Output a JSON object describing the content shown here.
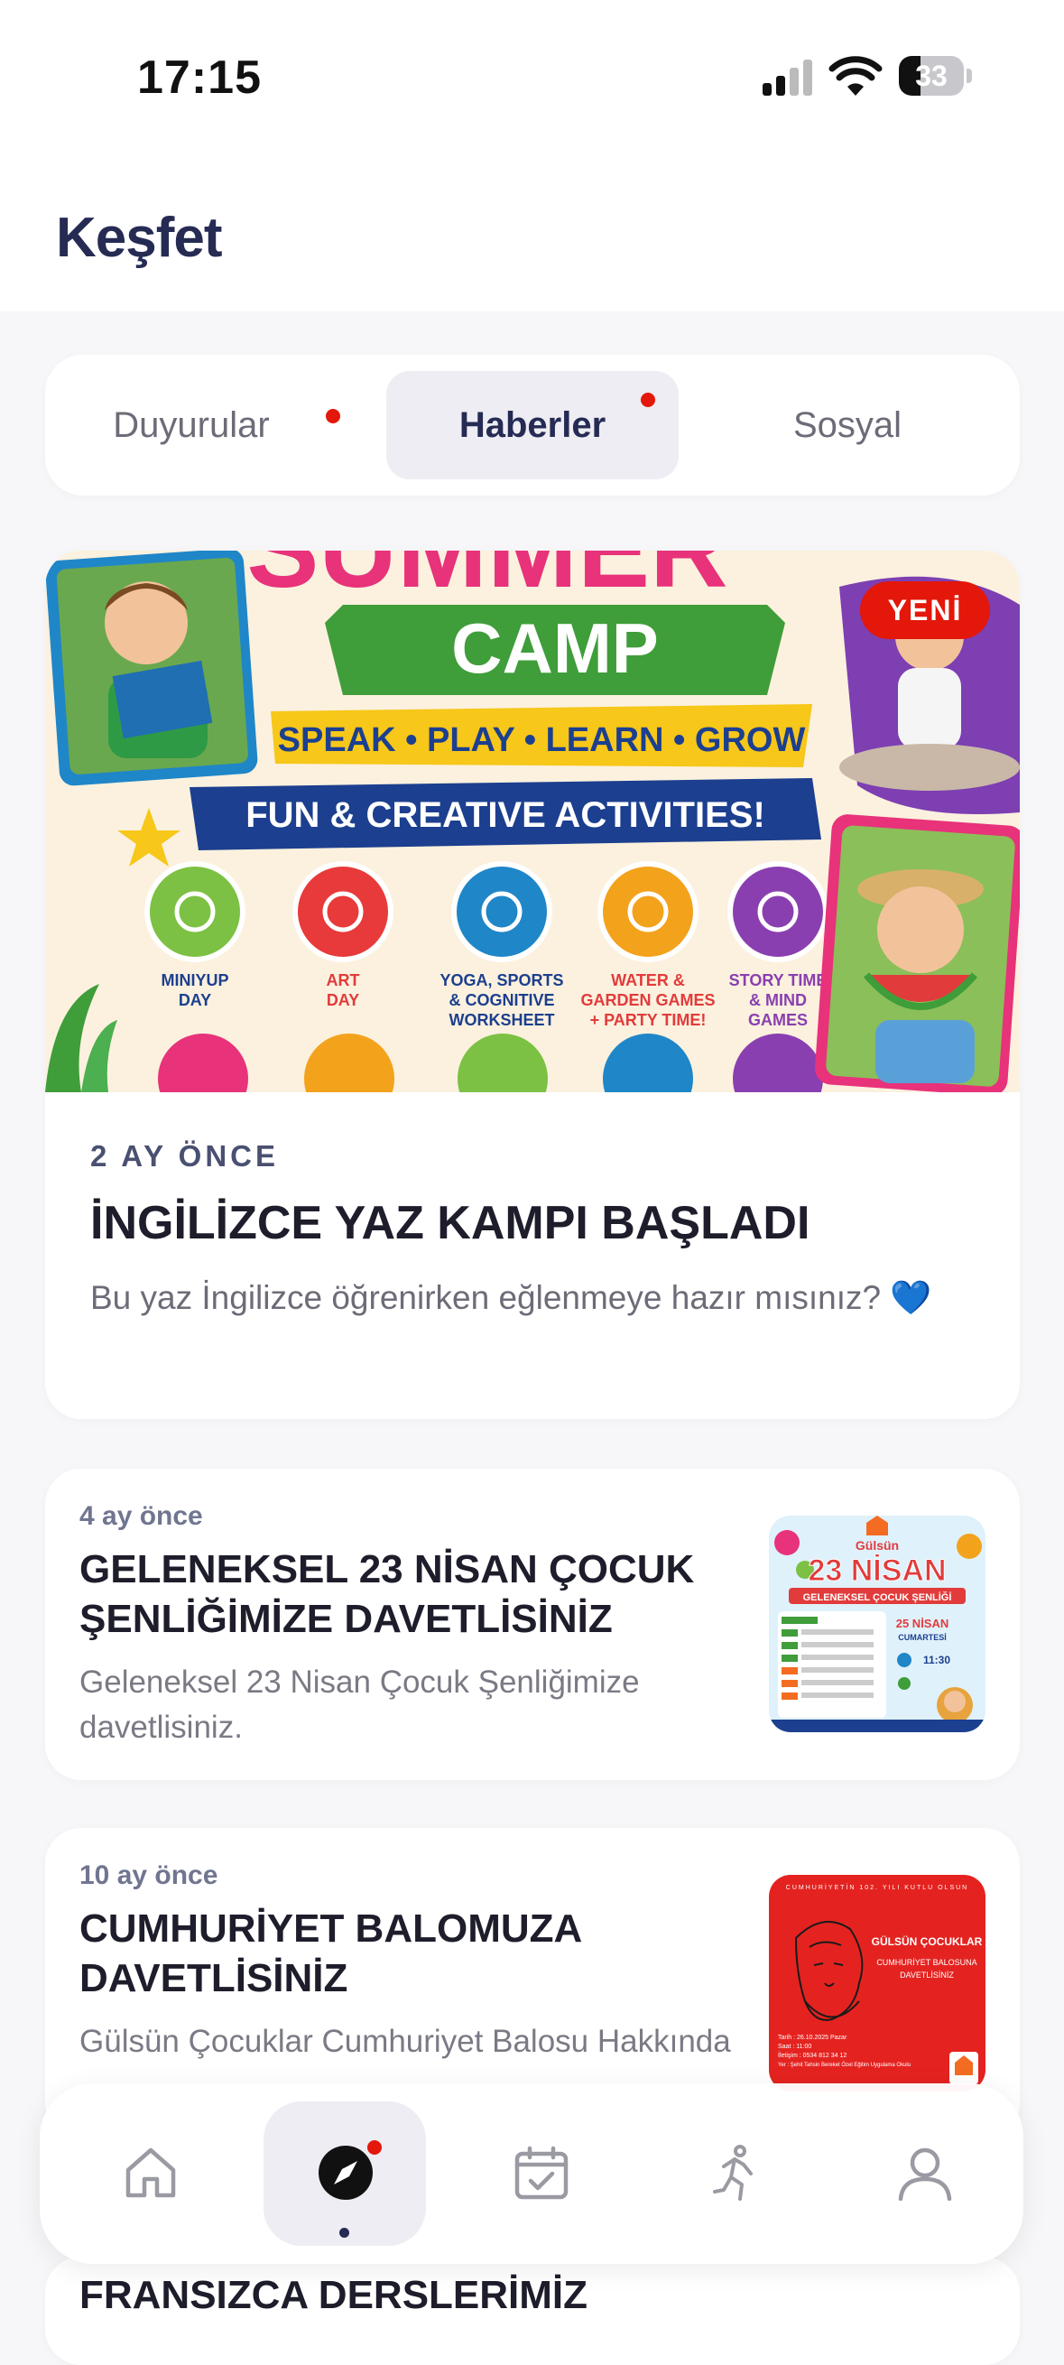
{
  "status_bar": {
    "time": "17:15",
    "battery": "33",
    "battery_level": 0.33
  },
  "header": {
    "title": "Keşfet"
  },
  "tabs": [
    {
      "label": "Duyurular",
      "active": false,
      "has_dot": true
    },
    {
      "label": "Haberler",
      "active": true,
      "has_dot": true
    },
    {
      "label": "Sosyal",
      "active": false,
      "has_dot": false
    }
  ],
  "featured": {
    "badge": "YENİ",
    "time": "2 AY ÖNCE",
    "title": "İNGİLİZCE YAZ KAMPI BAŞLADI",
    "description": "Bu yaz İngilizce öğrenirken eğlenmeye hazır mısınız? 💙",
    "image": {
      "headline_partial": "SUMMER",
      "camp": "CAMP",
      "tagline": "SPEAK • PLAY • LEARN • GROW",
      "banner": "FUN & CREATIVE ACTIVITIES!",
      "activities": [
        {
          "label1": "MINIYUP",
          "label2": "DAY",
          "color": "#7cc143"
        },
        {
          "label1": "ART",
          "label2": "DAY",
          "color": "#e83a3a"
        },
        {
          "label1": "YOGA, SPORTS",
          "label2": "& COGNITIVE",
          "label3": "WORKSHEET",
          "color": "#1f86c8"
        },
        {
          "label1": "WATER &",
          "label2": "GARDEN GAMES",
          "label3": "+ PARTY TIME!",
          "color": "#f3a21c"
        },
        {
          "label1": "STORY TIME",
          "label2": "& MIND",
          "label3": "GAMES",
          "color": "#8a3fb0"
        }
      ]
    }
  },
  "news": [
    {
      "time": "4 ay önce",
      "title": "GELENEKSEL 23 NİSAN ÇOCUK ŞENLİĞİMİZE DAVETLİSİNİZ",
      "description": "Geleneksel 23 Nisan Çocuk Şenliğimize davetlisiniz.",
      "thumb": {
        "brand": "Gülsün",
        "big": "23 NİSAN",
        "sub": "GELENEKSEL ÇOCUK ŞENLİĞİ",
        "date": "25 NİSAN",
        "day": "CUMARTESİ",
        "hour": "11:30"
      }
    },
    {
      "time": "10 ay önce",
      "title": "CUMHURİYET BALOMUZA DAVETLİSİNİZ",
      "description": "Gülsün Çocuklar Cumhuriyet Balosu Hakkında",
      "thumb": {
        "top": "CUMHURİYETİN 102. YILI KUTLU OLSUN",
        "brand": "GÜLSÜN ÇOCUKLAR",
        "line1": "CUMHURİYET BALOSUNA",
        "line2": "DAVETLİSİNİZ",
        "date": "Tarih : 26.10.2025 Pazar",
        "hour": "Saat : 11:00",
        "phone": "İletişim : 0534 812 34 12",
        "place": "Yer : Şehit Tahsin Bereket Özel Eğitim Uygulama Okulu"
      }
    }
  ],
  "partial_news": {
    "title": "FRANSIZCA DERSLERİMİZ"
  },
  "tabbar": [
    {
      "icon": "home-icon",
      "active": false
    },
    {
      "icon": "compass-icon",
      "active": true
    },
    {
      "icon": "calendar-check-icon",
      "active": false
    },
    {
      "icon": "activity-icon",
      "active": false
    },
    {
      "icon": "profile-icon",
      "active": false
    }
  ],
  "colors": {
    "brand_navy": "#262b54",
    "badge_red": "#e3170a",
    "background": "#f7f7f9"
  }
}
